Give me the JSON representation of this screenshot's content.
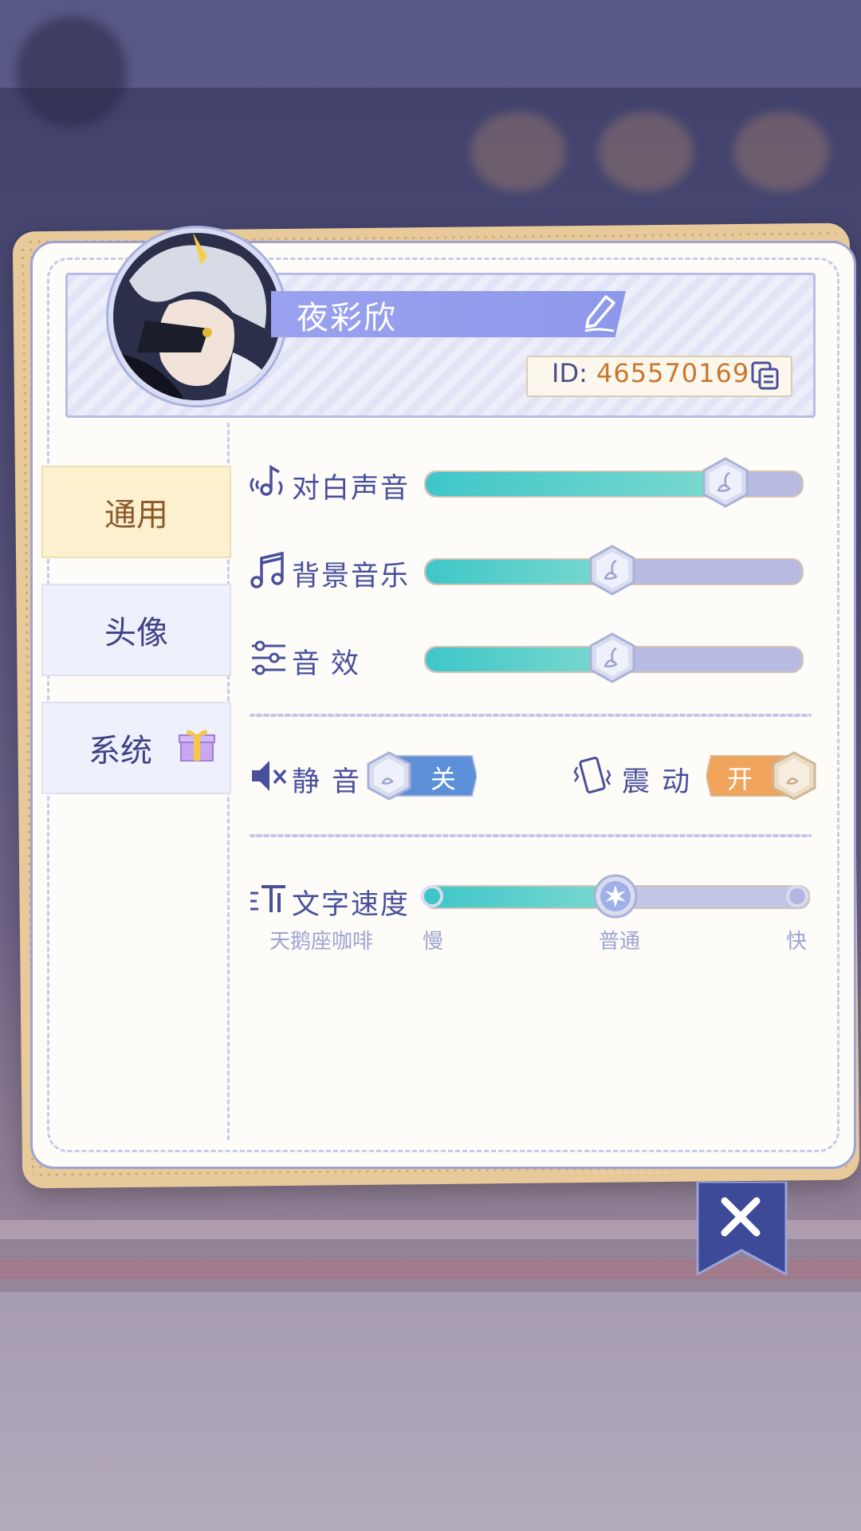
{
  "profile": {
    "name": "夜彩欣",
    "id_label": "ID:",
    "id_value": "465570169"
  },
  "tabs": [
    {
      "label": "通用",
      "active": true
    },
    {
      "label": "头像",
      "active": false
    },
    {
      "label": "系统",
      "active": false
    }
  ],
  "audio": {
    "dialogue": {
      "label": "对白声音",
      "level": 0.8
    },
    "music": {
      "label": "背景音乐",
      "level": 0.5
    },
    "effects": {
      "label": "音效",
      "level": 0.5
    }
  },
  "toggles": {
    "mute": {
      "label": "静 音",
      "state_label": "关",
      "on": false
    },
    "vibrate": {
      "label": "震 动",
      "state_label": "开",
      "on": true
    }
  },
  "text_speed": {
    "label": "文字速度",
    "sample": "天鹅座咖啡",
    "min_label": "慢",
    "mid_label": "普通",
    "max_label": "快",
    "level": 0.5
  },
  "colors": {
    "accent": "#4a4f9c",
    "fill": "#3fc6c9",
    "id_value": "#c8772d",
    "active_tab": "#fcf0cf"
  },
  "icons": [
    "dialogue-icon",
    "music-note-icon",
    "sliders-icon",
    "mute-speaker-icon",
    "vibrate-phone-icon",
    "text-speed-icon",
    "edit-pencil-icon",
    "copy-icon",
    "gift-icon",
    "close-icon"
  ]
}
